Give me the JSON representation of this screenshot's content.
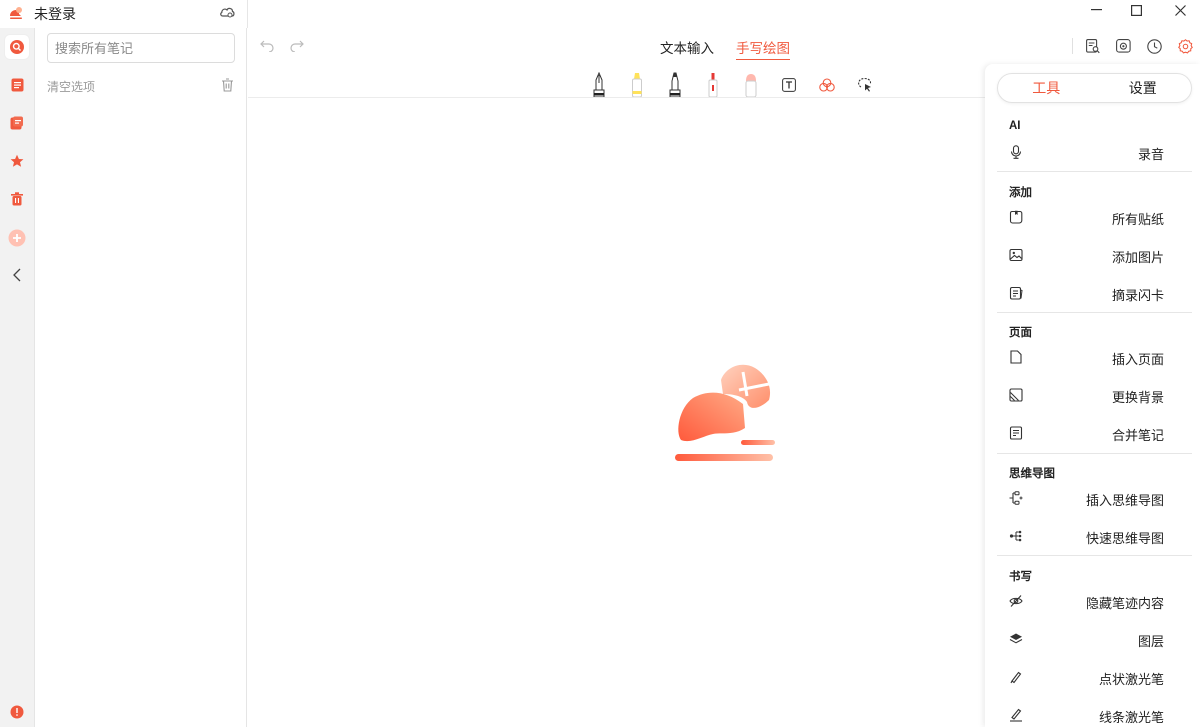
{
  "app": {
    "title": "未登录"
  },
  "colors": {
    "accent": "#f0593e",
    "accent_light": "#ffb08f"
  },
  "rail": {
    "items": [
      {
        "icon": "search-icon"
      },
      {
        "icon": "notes-list-icon"
      },
      {
        "icon": "notebook-icon"
      },
      {
        "icon": "star-icon"
      },
      {
        "icon": "trash-icon"
      },
      {
        "icon": "add-icon"
      },
      {
        "icon": "collapse-chevron-icon"
      }
    ]
  },
  "notelist": {
    "search_placeholder": "搜索所有笔记",
    "clear_label": "清空选项"
  },
  "editor": {
    "tabs": [
      {
        "label": "文本输入",
        "active": false
      },
      {
        "label": "手写绘图",
        "active": true
      }
    ],
    "draw_tools": [
      "fountain-pen-icon",
      "highlighter-icon",
      "pen-icon",
      "marker-icon",
      "eraser-icon",
      "text-box-icon",
      "shapes-icon",
      "lasso-icon"
    ]
  },
  "panel": {
    "segments": [
      {
        "label": "工具",
        "active": true
      },
      {
        "label": "设置",
        "active": false
      }
    ],
    "sections": [
      {
        "title": "AI",
        "items": [
          {
            "label": "录音",
            "icon": "microphone-icon"
          }
        ]
      },
      {
        "title": "添加",
        "items": [
          {
            "label": "所有贴纸",
            "icon": "sticker-icon"
          },
          {
            "label": "添加图片",
            "icon": "image-icon"
          },
          {
            "label": "摘录闪卡",
            "icon": "flashcard-icon"
          }
        ]
      },
      {
        "title": "页面",
        "items": [
          {
            "label": "插入页面",
            "icon": "page-icon"
          },
          {
            "label": "更换背景",
            "icon": "background-icon"
          },
          {
            "label": "合并笔记",
            "icon": "merge-icon"
          }
        ]
      },
      {
        "title": "思维导图",
        "items": [
          {
            "label": "插入思维导图",
            "icon": "mindmap-insert-icon"
          },
          {
            "label": "快速思维导图",
            "icon": "mindmap-quick-icon"
          }
        ]
      },
      {
        "title": "书写",
        "items": [
          {
            "label": "隐藏笔迹内容",
            "icon": "eye-off-icon"
          },
          {
            "label": "图层",
            "icon": "layers-icon"
          },
          {
            "label": "点状激光笔",
            "icon": "laser-dot-icon"
          },
          {
            "label": "线条激光笔",
            "icon": "laser-line-icon"
          }
        ]
      }
    ]
  }
}
